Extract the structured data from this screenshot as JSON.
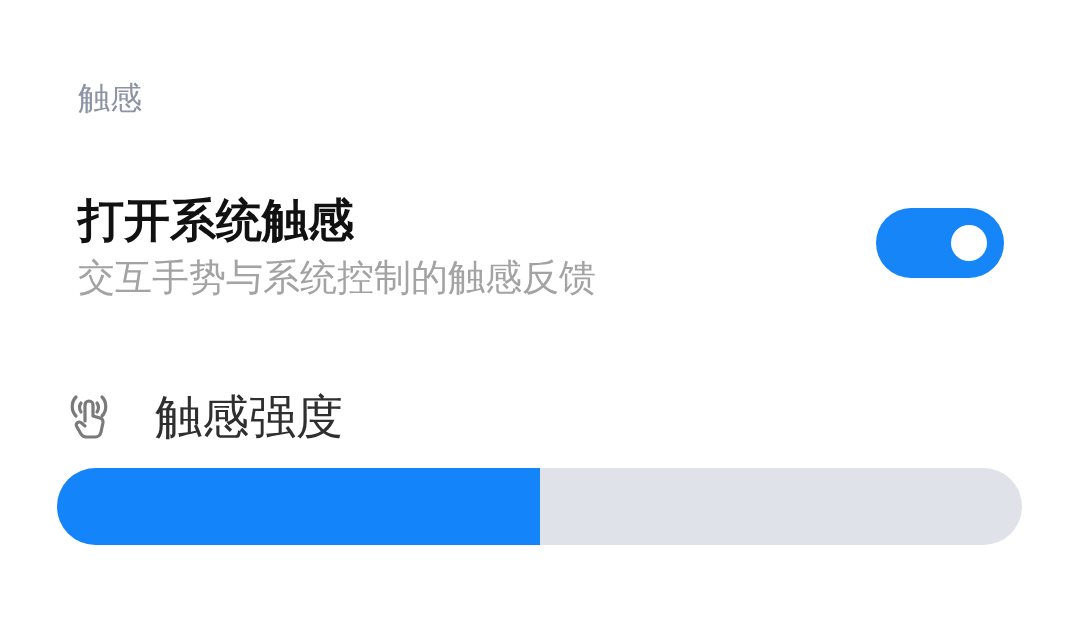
{
  "section_header": "触感",
  "haptics_toggle": {
    "title": "打开系统触感",
    "subtitle": "交互手势与系统控制的触感反馈",
    "on": true
  },
  "intensity_slider": {
    "label": "触感强度",
    "level": 0.5
  }
}
